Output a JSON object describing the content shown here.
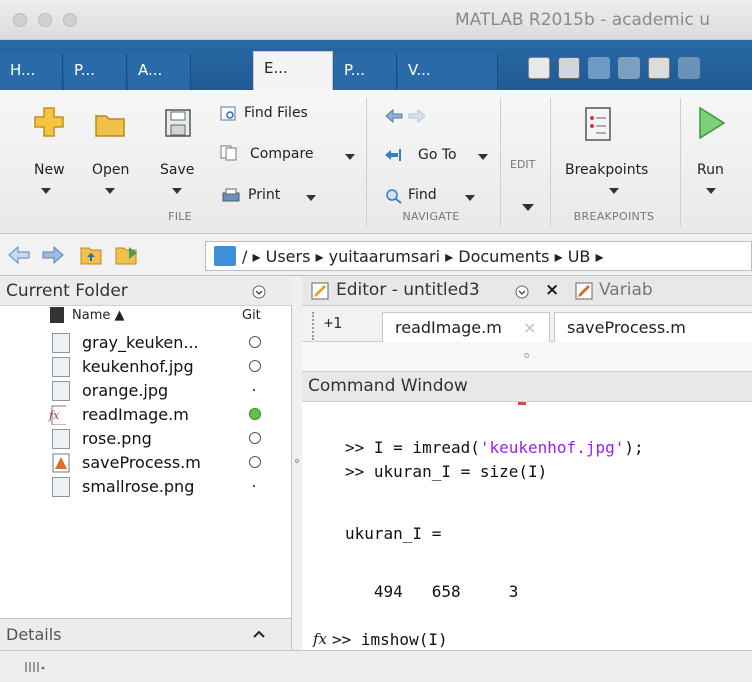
{
  "window": {
    "title": "MATLAB R2015b - academic u"
  },
  "tabs": [
    {
      "label": "H..."
    },
    {
      "label": "P..."
    },
    {
      "label": "A..."
    },
    {
      "label": "E..."
    },
    {
      "label": "P..."
    },
    {
      "label": "V..."
    }
  ],
  "toolstrip": {
    "file": {
      "section_label": "FILE",
      "new_label": "New",
      "open_label": "Open",
      "save_label": "Save",
      "find_files_label": "Find Files",
      "compare_label": "Compare",
      "print_label": "Print"
    },
    "navigate": {
      "section_label": "NAVIGATE",
      "goto_label": "Go To",
      "find_label": "Find"
    },
    "edit": {
      "section_label": "EDIT"
    },
    "breakpoints": {
      "section_label": "BREAKPOINTS",
      "breakpoints_label": "Breakpoints"
    },
    "run": {
      "run_label": "Run"
    }
  },
  "path": {
    "segments": [
      "/",
      "Users",
      "yuitaarumsari",
      "Documents",
      "UB"
    ]
  },
  "current_folder": {
    "title": "Current Folder",
    "col_name": "Name ▲",
    "col_git": "Git",
    "files": [
      {
        "name": "gray_keuken...",
        "git": "circle"
      },
      {
        "name": "keukenhof.jpg",
        "git": "circle"
      },
      {
        "name": "orange.jpg",
        "git": "dot"
      },
      {
        "name": "readImage.m",
        "git": "green"
      },
      {
        "name": "rose.png",
        "git": "circle"
      },
      {
        "name": "saveProcess.m",
        "git": "circle"
      },
      {
        "name": "smallrose.png",
        "git": "dot"
      }
    ],
    "details_label": "Details"
  },
  "editor": {
    "title": "Editor - untitled3",
    "variables_label": "Variab",
    "tab_plus": "+1",
    "tabs": [
      "readImage.m",
      "saveProcess.m"
    ]
  },
  "command_window": {
    "title": "Command Window",
    "line1_prompt": ">> I = imread(",
    "line1_str": "'keukenhof.jpg'",
    "line1_end": ");",
    "line2": ">> ukuran_I = size(I)",
    "line3": "ukuran_I =",
    "line4": "   494   658     3",
    "line5": ">> imshow(I)",
    "fx_label": "fx"
  },
  "colors": {
    "tabstrip": "#2a69a6",
    "git_clean": "#5ec545",
    "string": "#a020f0"
  }
}
